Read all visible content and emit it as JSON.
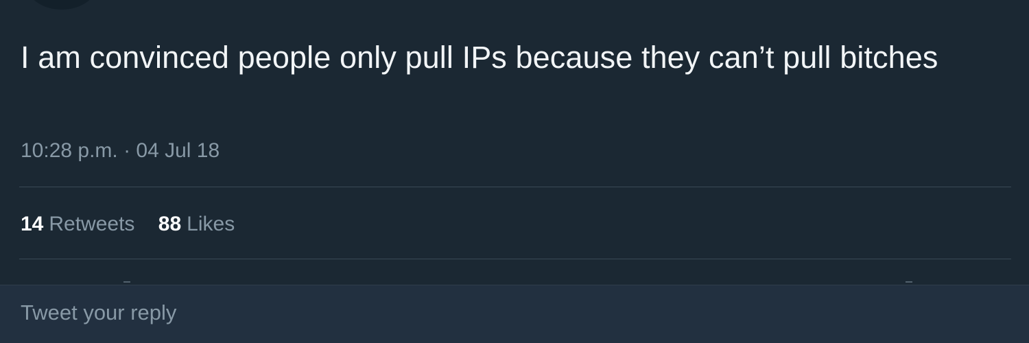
{
  "tweet": {
    "text": "I am convinced people only pull IPs because they can’t pull bitches",
    "timestamp": "10:28 p.m. · 04 Jul 18"
  },
  "stats": {
    "retweets": {
      "count": "14",
      "label": "Retweets"
    },
    "likes": {
      "count": "88",
      "label": "Likes"
    }
  },
  "reply": {
    "placeholder": "Tweet your reply"
  },
  "colors": {
    "background": "#1b2833",
    "reply_bar": "#223040",
    "primary_text": "#f2f5f7",
    "secondary_text": "#8899a6",
    "divider": "#3b4a56"
  }
}
